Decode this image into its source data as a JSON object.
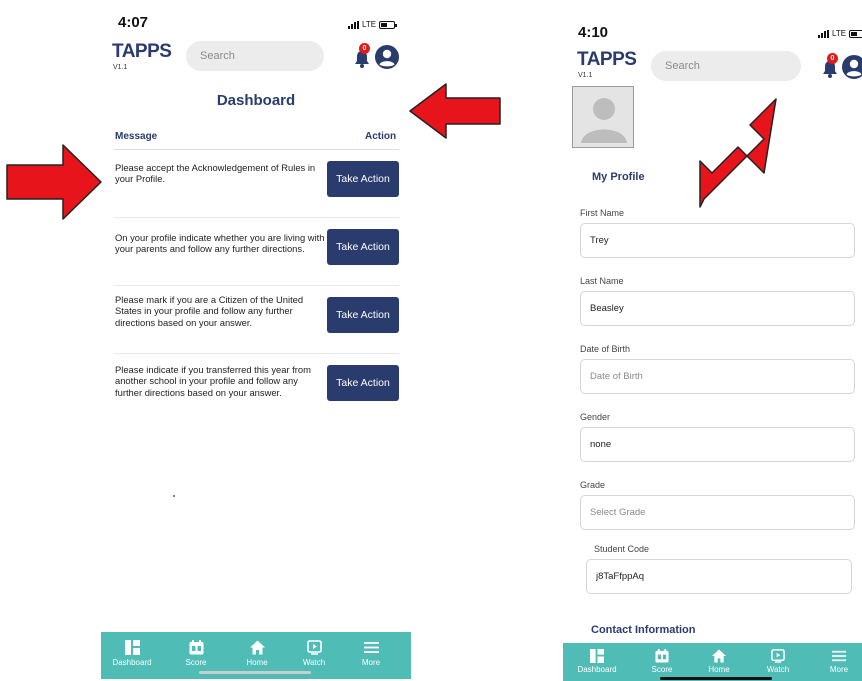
{
  "left_screen": {
    "status": {
      "time": "4:07",
      "carrier": "LTE"
    },
    "header": {
      "logo": "TAPPS",
      "version": "V1.1",
      "search_placeholder": "Search",
      "notification_count": "0"
    },
    "dashboard": {
      "title": "Dashboard",
      "columns": {
        "message": "Message",
        "action": "Action"
      },
      "rows": [
        {
          "message": "Please accept the Acknowledgement of Rules in your Profile.",
          "action": "Take Action"
        },
        {
          "message": "On your profile indicate whether you are living with your parents and follow any further directions.",
          "action": "Take Action"
        },
        {
          "message": "Please mark if you are a Citizen of the United States in your profile and follow any further directions based on your answer.",
          "action": "Take Action"
        },
        {
          "message": "Please indicate if you transferred this year from another school in your profile and follow any further directions based on your answer.",
          "action": "Take Action"
        }
      ]
    },
    "tabbar": [
      "Dashboard",
      "Score",
      "Home",
      "Watch",
      "More"
    ]
  },
  "right_screen": {
    "status": {
      "time": "4:10",
      "carrier": "LTE"
    },
    "header": {
      "logo": "TAPPS",
      "version": "V1.1",
      "search_placeholder": "Search",
      "notification_count": "0"
    },
    "profile": {
      "title": "My Profile",
      "fields": [
        {
          "label": "First Name",
          "value": "Trey",
          "placeholder": ""
        },
        {
          "label": "Last Name",
          "value": "Beasley",
          "placeholder": ""
        },
        {
          "label": "Date of Birth",
          "value": "",
          "placeholder": "Date of Birth"
        },
        {
          "label": "Gender",
          "value": "none",
          "placeholder": ""
        },
        {
          "label": "Grade",
          "value": "",
          "placeholder": "Select Grade"
        },
        {
          "label": "Student Code",
          "value": "j8TaFfppAq",
          "placeholder": ""
        }
      ],
      "contact_title": "Contact Information"
    },
    "tabbar": [
      "Dashboard",
      "Score",
      "Home",
      "Watch",
      "More"
    ]
  },
  "colors": {
    "brand": "#2a3b6e",
    "tabbar": "#4fbcb6",
    "annotation_arrow": "#e8141b",
    "badge": "#e11a1a"
  },
  "icons": [
    "bell-icon",
    "profile-icon",
    "dashboard-icon",
    "score-icon",
    "home-icon",
    "watch-icon",
    "more-icon",
    "avatar-placeholder-icon"
  ]
}
